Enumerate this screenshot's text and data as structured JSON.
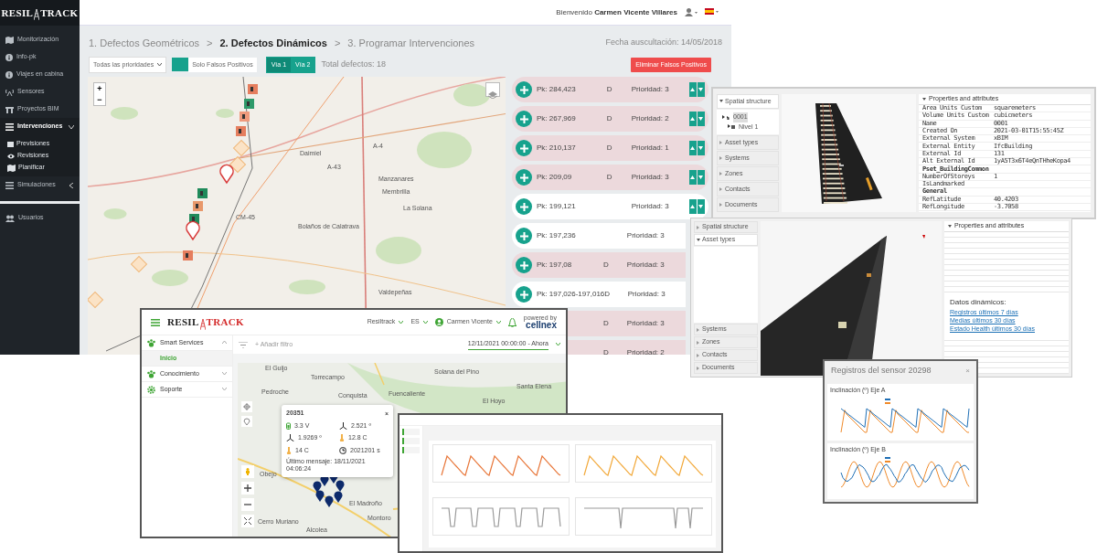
{
  "main_app": {
    "logo": {
      "left": "RESIL",
      "right": "TRACK"
    },
    "sidebar": [
      {
        "label": "Monitorización",
        "selected": false
      },
      {
        "label": "Info-pk",
        "selected": false
      },
      {
        "label": "Viajes en cabina",
        "selected": false
      },
      {
        "label": "Sensores",
        "selected": false
      },
      {
        "label": "Proyectos BIM",
        "selected": false
      },
      {
        "label": "Intervenciones",
        "selected": true,
        "expanded": true,
        "children": [
          {
            "label": "Previsiones"
          },
          {
            "label": "Revisiones"
          },
          {
            "label": "Planificar"
          }
        ]
      },
      {
        "label": "Simulaciones",
        "selected": false,
        "expanded": false
      },
      {
        "label": "Usuarios",
        "selected": false
      }
    ],
    "header": {
      "welcome": "Bienvenido",
      "user": "Carmen Vicente Villares"
    },
    "steps": [
      {
        "label": "1. Defectos Geométricos",
        "selected": false
      },
      {
        "label": "2. Defectos Dinámicos",
        "selected": true
      },
      {
        "label": "3. Programar Intervenciones",
        "selected": false
      }
    ],
    "step_separators": [
      ">",
      ">"
    ],
    "date": "Fecha auscultación: 14/05/2018",
    "filters": {
      "priority": "Todas las prioridades",
      "false_positive_label": "Solo Falsos Positivos",
      "false_positive_on": false,
      "tracks": [
        {
          "label": "Vía 1",
          "selected": true
        },
        {
          "label": "Vía 2",
          "selected": false
        }
      ],
      "total": "Total defectos: 18"
    },
    "delete_button": "Eliminar Falsos Positivos",
    "map": {
      "zoom_in": "+",
      "zoom_out": "−",
      "labels": [
        "Daimiel",
        "A-43",
        "A-4",
        "Manzanares",
        "Membrilla",
        "La Solana",
        "CM-45",
        "Bolaños de Calatrava",
        "Valdepeñas"
      ]
    },
    "defects": [
      {
        "pk": "Pk: 284,423",
        "type": "D",
        "priority": "Prioridad: 3",
        "flagged": true
      },
      {
        "pk": "Pk: 267,969",
        "type": "D",
        "priority": "Prioridad: 2",
        "flagged": true
      },
      {
        "pk": "Pk: 210,137",
        "type": "D",
        "priority": "Prioridad: 1",
        "flagged": true
      },
      {
        "pk": "Pk: 209,09",
        "type": "D",
        "priority": "Prioridad: 3",
        "flagged": true
      },
      {
        "pk": "Pk: 199,121",
        "priority": "Prioridad: 3",
        "flagged": false
      },
      {
        "pk": "Pk: 197,236",
        "priority": "Prioridad: 3",
        "flagged": false
      },
      {
        "pk": "Pk: 197,08",
        "type": "D",
        "priority": "Prioridad: 3",
        "flagged": true
      },
      {
        "pk": "Pk: 197,026-197,016",
        "type": "D",
        "priority": "Prioridad: 3",
        "flagged": false
      },
      {
        "type": "D",
        "priority": "Prioridad: 3",
        "flagged": true
      },
      {
        "type": "D",
        "priority": "Prioridad: 2",
        "flagged": true
      }
    ]
  },
  "bim_viewer": {
    "sections": [
      {
        "label": "Spatial structure",
        "expanded": true
      },
      {
        "label": "Asset types",
        "expanded": false
      },
      {
        "label": "Systems",
        "expanded": false
      },
      {
        "label": "Zones",
        "expanded": false
      },
      {
        "label": "Contacts",
        "expanded": false
      },
      {
        "label": "Documents",
        "expanded": false
      }
    ],
    "tree": [
      {
        "label": "0001",
        "selected": true,
        "children": [
          {
            "label": "Nivel 1"
          }
        ]
      }
    ],
    "properties_title": "Properties and attributes",
    "properties": [
      {
        "kind": "pair",
        "key": "Area Units Custom",
        "value": "squaremeters"
      },
      {
        "kind": "pair",
        "key": "Volume Units Custom",
        "value": "cubicmeters"
      },
      {
        "kind": "pair",
        "key": "Name",
        "value": "0001"
      },
      {
        "kind": "pair",
        "key": "Created On",
        "value": "2021-03-01T15:55:45Z"
      },
      {
        "kind": "pair",
        "key": "External System",
        "value": "xBIM"
      },
      {
        "kind": "pair",
        "key": "External Entity",
        "value": "IfcBuilding"
      },
      {
        "kind": "pair",
        "key": "External Id",
        "value": "131"
      },
      {
        "kind": "pair",
        "key": "Alt External Id",
        "value": "1yA5T3x6T4eQnTHheKopa4"
      },
      {
        "kind": "header",
        "key": "Pset_BuildingCommon"
      },
      {
        "kind": "pair",
        "key": "NumberOfStoreys",
        "value": "1"
      },
      {
        "kind": "pair",
        "key": "IsLandmarked"
      },
      {
        "kind": "header",
        "key": "General"
      },
      {
        "kind": "pair",
        "key": "RefLatitude",
        "value": "40.4203"
      },
      {
        "kind": "pair",
        "key": "RefLongitude",
        "value": "-3.7058"
      }
    ]
  },
  "bim_sensor_viewer": {
    "sections_top": [
      {
        "label": "Spatial structure",
        "expanded": false
      },
      {
        "label": "Asset types",
        "expanded": true
      }
    ],
    "sections_bottom": [
      {
        "label": "Systems",
        "expanded": false
      },
      {
        "label": "Zones",
        "expanded": false
      },
      {
        "label": "Contacts",
        "expanded": false
      },
      {
        "label": "Documents",
        "expanded": false
      }
    ],
    "properties_title": "Properties and attributes",
    "dynamic_title": "Datos dinámicos:",
    "links": [
      "Registros últimos 7 días",
      "Medias últimos 30 días",
      "Estado Health últimos 30 días"
    ]
  },
  "sensor_modal": {
    "title": "Registros del sensor 20298",
    "close": "×",
    "charts": [
      {
        "title": "Inclinación (º) Eje A"
      },
      {
        "title": "Inclinación (º) Eje B"
      }
    ]
  },
  "smart_app": {
    "logo": {
      "left": "RESIL",
      "right": "TRACK"
    },
    "header_items": [
      {
        "label": "Resiltrack",
        "kind": "menu"
      },
      {
        "label": "ES",
        "kind": "menu"
      },
      {
        "label": "Carmen Vicente",
        "kind": "user"
      }
    ],
    "powered_by": "powered by",
    "partner": "cellnex",
    "sidebar": [
      {
        "label": "Smart Services",
        "expanded": true,
        "children": [
          {
            "label": "Inicio",
            "selected": true
          }
        ]
      },
      {
        "label": "Conocimiento",
        "expanded": false
      },
      {
        "label": "Soporte",
        "expanded": false
      }
    ],
    "filter": "+ Añadir filtro",
    "date_range": "12/11/2021 00:00:00 - Ahora",
    "map_labels": [
      "El Guijo",
      "Torrecampo",
      "Pedroche",
      "Conquista",
      "Fuencaliente",
      "Solana del Pino",
      "El Hoyo",
      "Santa Elena",
      "Obejo",
      "El Madroño",
      "Montoro",
      "Cerro Muriano",
      "Alcolea"
    ],
    "popup": {
      "title": "20351",
      "close": "×",
      "metrics": [
        {
          "kind": "battery",
          "value": "3.3 V"
        },
        {
          "kind": "tilt",
          "value": "2.521 º"
        },
        {
          "kind": "tilt",
          "value": "1.9269 º"
        },
        {
          "kind": "temperature",
          "value": "12.8 C"
        },
        {
          "kind": "temperature",
          "value": "14 C"
        },
        {
          "kind": "time",
          "value": "2021201 s"
        }
      ],
      "last_message": "Último mensaje: 18/11/2021 04:06:24"
    }
  },
  "device_dashboard": {
    "charts": [
      {
        "kind": "peaks",
        "color": "#e8773a"
      },
      {
        "kind": "peaks",
        "color": "#f2a93b"
      },
      {
        "kind": "dips",
        "color": "#9a9a9a"
      },
      {
        "kind": "spikes",
        "color": "#9a9a9a"
      }
    ]
  }
}
